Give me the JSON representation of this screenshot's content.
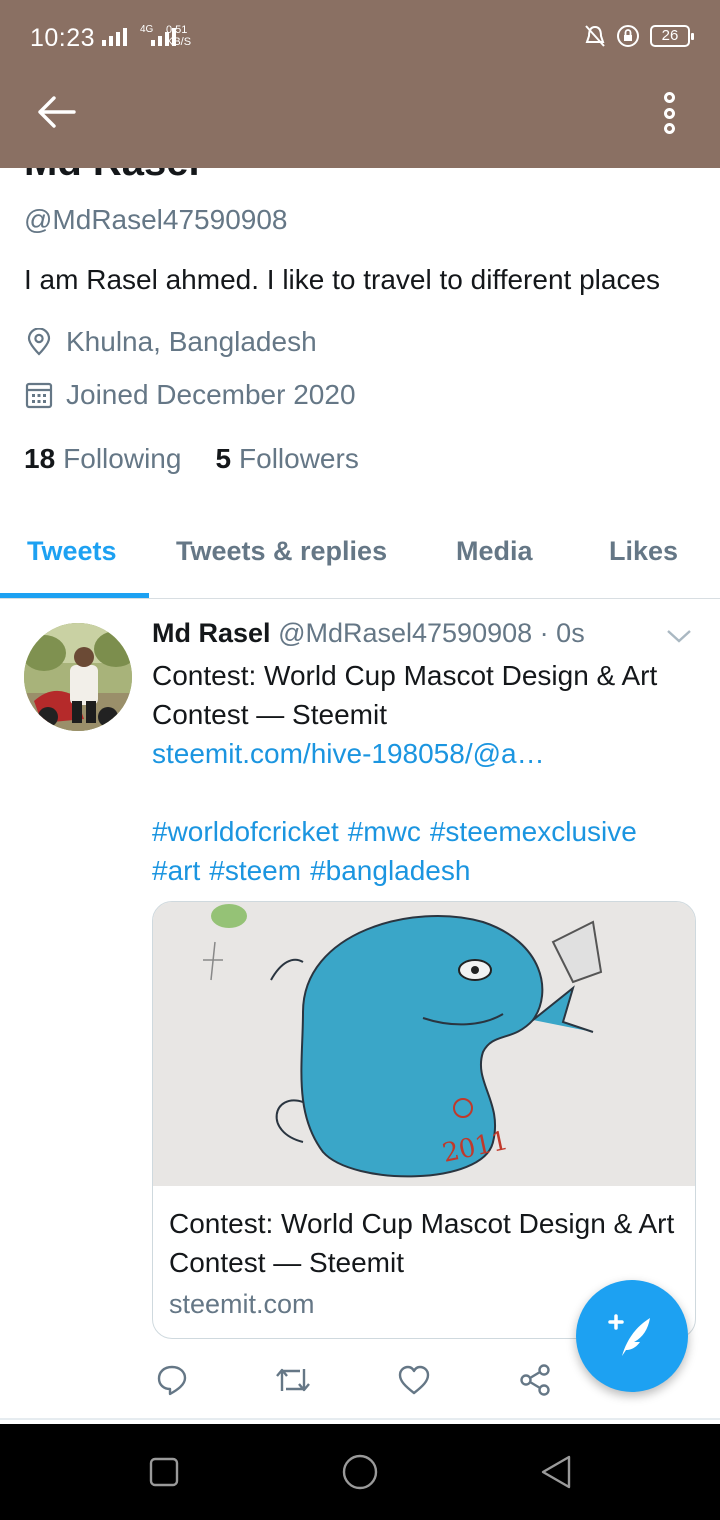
{
  "status_bar": {
    "time": "10:23",
    "network": "4G",
    "speed_value": "0.51",
    "speed_unit": "KB/S",
    "battery": "26"
  },
  "app_bar": {
    "back_icon": "arrow-left-icon",
    "more_icon": "more-vertical-icon",
    "background_color": "#8a7063"
  },
  "profile": {
    "name": "Md Rasel",
    "handle": "@MdRasel47590908",
    "bio": "I am Rasel ahmed. I like to travel to different places",
    "location": "Khulna, Bangladesh",
    "joined": "Joined December 2020",
    "following_count": "18",
    "following_label": "Following",
    "followers_count": "5",
    "followers_label": "Followers"
  },
  "tabs": [
    {
      "label": "Tweets",
      "active": true
    },
    {
      "label": "Tweets & replies",
      "active": false
    },
    {
      "label": "Media",
      "active": false
    },
    {
      "label": "Likes",
      "active": false
    }
  ],
  "tweet": {
    "author_name": "Md Rasel",
    "author_handle": "@MdRasel47590908",
    "separator": "·",
    "time": "0s",
    "text": "Contest: World Cup Mascot Design & Art Contest — Steemit",
    "link": "steemit.com/hive-198058/@a…",
    "hashtags": [
      "#worldofcricket",
      "#mwc",
      "#steemexclusive",
      "#art",
      "#steem",
      "#bangladesh"
    ],
    "card": {
      "title": "Contest: World Cup Mascot Design & Art Contest — Steemit",
      "domain": "steemit.com",
      "image_text": "2011"
    },
    "actions": [
      "reply-icon",
      "retweet-icon",
      "like-icon",
      "share-icon"
    ]
  },
  "fab": {
    "icon": "compose-tweet-icon",
    "color": "#1da1f2"
  },
  "accent_color": "#1da1f2",
  "nav_bar": [
    "recents-square-icon",
    "home-circle-icon",
    "back-triangle-icon"
  ]
}
